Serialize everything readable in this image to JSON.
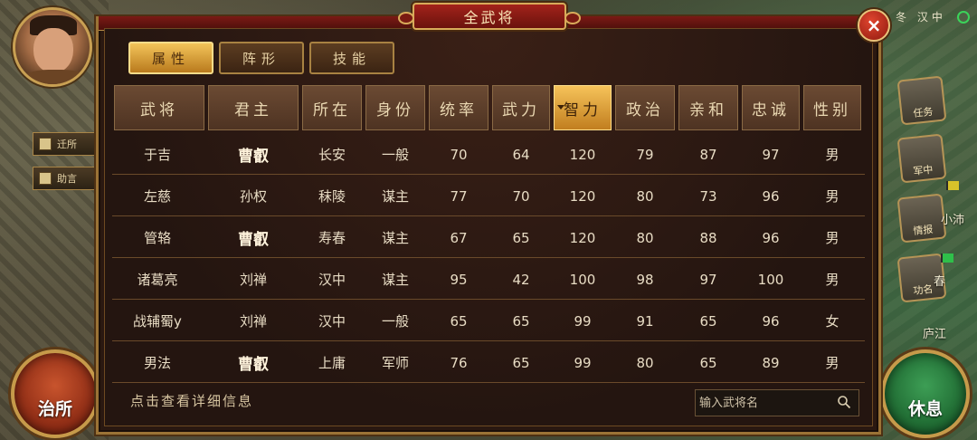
{
  "title": "全武将",
  "close_label": "×",
  "tabs": [
    {
      "label": "属性",
      "active": true
    },
    {
      "label": "阵形",
      "active": false
    },
    {
      "label": "技能",
      "active": false
    }
  ],
  "columns": [
    {
      "label": "武将"
    },
    {
      "label": "君主"
    },
    {
      "label": "所在"
    },
    {
      "label": "身份"
    },
    {
      "label": "统率"
    },
    {
      "label": "武力"
    },
    {
      "label": "智力",
      "sorted": true
    },
    {
      "label": "政治"
    },
    {
      "label": "亲和"
    },
    {
      "label": "忠诚"
    },
    {
      "label": "性别"
    }
  ],
  "rows": [
    [
      "于吉",
      "曹叡",
      "长安",
      "一般",
      "70",
      "64",
      "120",
      "79",
      "87",
      "97",
      "男"
    ],
    [
      "左慈",
      "孙权",
      "秣陵",
      "谋主",
      "77",
      "70",
      "120",
      "80",
      "73",
      "96",
      "男"
    ],
    [
      "管辂",
      "曹叡",
      "寿春",
      "谋主",
      "67",
      "65",
      "120",
      "80",
      "88",
      "96",
      "男"
    ],
    [
      "诸葛亮",
      "刘禅",
      "汉中",
      "谋主",
      "95",
      "42",
      "100",
      "98",
      "97",
      "100",
      "男"
    ],
    [
      "战辅蜀y",
      "刘禅",
      "汉中",
      "一般",
      "65",
      "65",
      "99",
      "91",
      "65",
      "96",
      "女"
    ],
    [
      "男法",
      "曹叡",
      "上庸",
      "军师",
      "76",
      "65",
      "99",
      "80",
      "65",
      "89",
      "男"
    ]
  ],
  "footer": {
    "hint": "点击查看详细信息",
    "search_placeholder": "输入武将名"
  },
  "left_hud": {
    "button1": "迁所",
    "button2": "助言",
    "main_button": "治所"
  },
  "right_hud": {
    "top_text": "冬 汉中",
    "icons": [
      "任务",
      "军中",
      "情报",
      "功名"
    ],
    "map_labels": [
      "小沛",
      "春",
      "庐江"
    ],
    "main_button": "休息"
  },
  "colors": {
    "panel_bg": "#2a1811",
    "gold_border": "#9b7336",
    "title_red": "#a3231b",
    "active_tab": "#f3c45a",
    "rest_green": "#1f6a32",
    "office_red": "#8e2c15"
  }
}
